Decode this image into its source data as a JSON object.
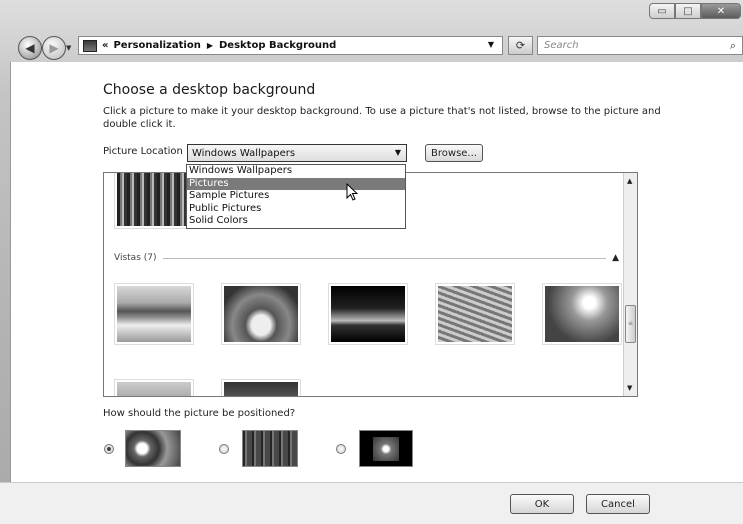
{
  "window": {
    "minimize_icon": "minimize-icon",
    "maximize_icon": "maximize-icon",
    "close_icon": "close-icon"
  },
  "nav": {
    "breadcrumb_overflow": "«",
    "breadcrumb": [
      "Personalization",
      "Desktop Background"
    ],
    "search_placeholder": "Search"
  },
  "page": {
    "heading": "Choose a desktop background",
    "description": "Click a picture to make it your desktop background. To use a picture that's not listed, browse to the picture and double click it.",
    "picture_location_label": "Picture Location",
    "picture_location_value": "Windows Wallpapers",
    "browse_label": "Browse...",
    "dropdown_options": [
      "Windows Wallpapers",
      "Pictures",
      "Sample Pictures",
      "Public Pictures",
      "Solid Colors"
    ],
    "dropdown_highlighted": "Pictures",
    "group_label": "Vistas (7)",
    "position_question": "How should the picture be positioned?",
    "position_options": [
      "fill",
      "tile",
      "center"
    ],
    "position_selected": "fill"
  },
  "footer": {
    "ok_label": "OK",
    "cancel_label": "Cancel"
  },
  "colors": {
    "dropdown_highlight": "#7a7a7a"
  }
}
